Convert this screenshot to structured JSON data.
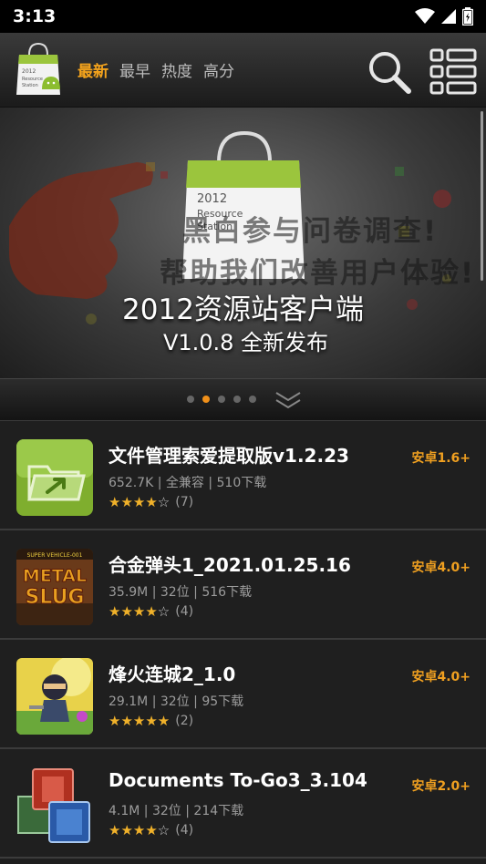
{
  "status_bar": {
    "time": "3:13"
  },
  "header": {
    "logo_lines": [
      "2012",
      "Resource",
      "Station"
    ],
    "tabs": [
      {
        "label": "最新",
        "active": true
      },
      {
        "label": "最早",
        "active": false
      },
      {
        "label": "热度",
        "active": false
      },
      {
        "label": "高分",
        "active": false
      }
    ],
    "icons": [
      "search-icon",
      "list-menu-icon"
    ]
  },
  "banner": {
    "bag_lines": [
      "2012",
      "Resource",
      "Station"
    ],
    "overlay_line1": "黑白参与问卷调查!",
    "overlay_line2": "帮助我们改善用户体验!",
    "title": "2012资源站客户端",
    "subtitle": "V1.0.8 全新发布"
  },
  "pager": {
    "total": 5,
    "current": 2
  },
  "apps": [
    {
      "name": "文件管理索爱提取版v1.2.23",
      "size": "652.7K",
      "compat": "全兼容",
      "downloads": "510下载",
      "stars": 4,
      "rating_count": "(7)",
      "requirement": "安卓1.6+",
      "icon": "file-manager-icon"
    },
    {
      "name": "合金弹头1_2021.01.25.16",
      "size": "35.9M",
      "compat": "32位",
      "downloads": "516下载",
      "stars": 4,
      "rating_count": "(4)",
      "requirement": "安卓4.0+",
      "icon": "metal-slug-icon",
      "icon_text": [
        "SUPER VEHICLE-001",
        "METAL",
        "SLUG"
      ]
    },
    {
      "name": "烽火连城2_1.0",
      "size": "29.1M",
      "compat": "32位",
      "downloads": "95下载",
      "stars": 5,
      "rating_count": "(2)",
      "requirement": "安卓4.0+",
      "icon": "ninja-game-icon"
    },
    {
      "name": "Documents To-Go3_3.104",
      "size": "4.1M",
      "compat": "32位",
      "downloads": "214下载",
      "stars": 4,
      "rating_count": "(4)",
      "requirement": "安卓2.0+",
      "icon": "documents-icon"
    }
  ],
  "colors": {
    "accent": "#f4a31c",
    "background": "#1f1f1f",
    "star": "#f0b12a"
  }
}
